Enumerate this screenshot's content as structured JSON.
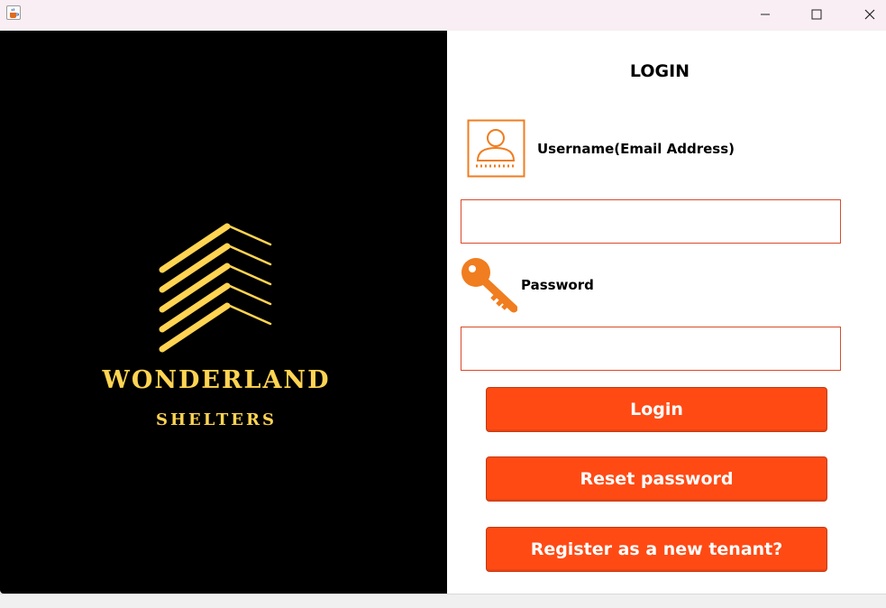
{
  "window": {
    "app_icon": "java-cup-icon",
    "controls": {
      "minimize": "minimize-icon",
      "maximize": "maximize-icon",
      "close": "close-icon"
    }
  },
  "branding": {
    "name": "WONDERLAND",
    "tagline": "SHELTERS",
    "logo_icon": "chevron-stripes-logo",
    "color": "#ffd452"
  },
  "form": {
    "title": "LOGIN",
    "username": {
      "label": "Username(Email Address)",
      "value": "",
      "placeholder": "",
      "icon": "user-badge-icon"
    },
    "password": {
      "label": "Password",
      "value": "",
      "placeholder": "",
      "icon": "key-icon"
    },
    "buttons": {
      "login": "Login",
      "reset": "Reset password",
      "register": "Register as a new tenant?"
    },
    "accent_color": "#ff4a14"
  }
}
